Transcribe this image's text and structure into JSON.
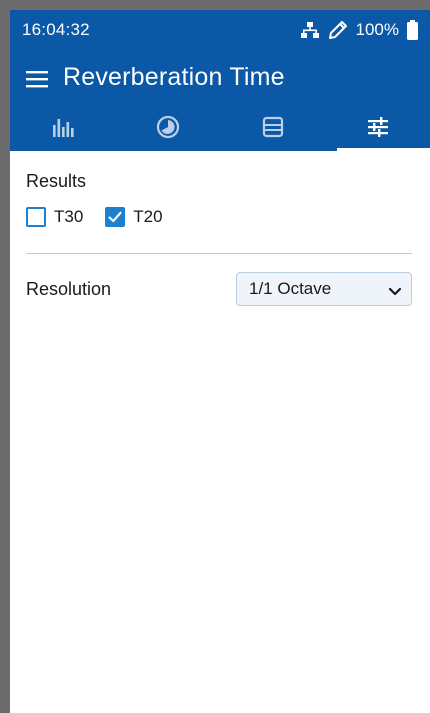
{
  "status_bar": {
    "time": "16:04:32",
    "battery": "100%",
    "icons": [
      "network-icon",
      "pen-icon",
      "battery-icon"
    ]
  },
  "app_bar": {
    "title": "Reverberation Time",
    "menu_icon": "menu-icon"
  },
  "tabs": [
    {
      "icon": "bar-chart-icon",
      "active": false
    },
    {
      "icon": "gauge-icon",
      "active": false
    },
    {
      "icon": "list-icon",
      "active": false
    },
    {
      "icon": "settings-sliders-icon",
      "active": true
    }
  ],
  "settings": {
    "results_label": "Results",
    "checkboxes": [
      {
        "label": "T30",
        "checked": false
      },
      {
        "label": "T20",
        "checked": true
      }
    ],
    "resolution_label": "Resolution",
    "resolution_value": "1/1 Octave"
  },
  "colors": {
    "header": "#0a58a6",
    "checkbox_accent": "#1d7fcf"
  }
}
